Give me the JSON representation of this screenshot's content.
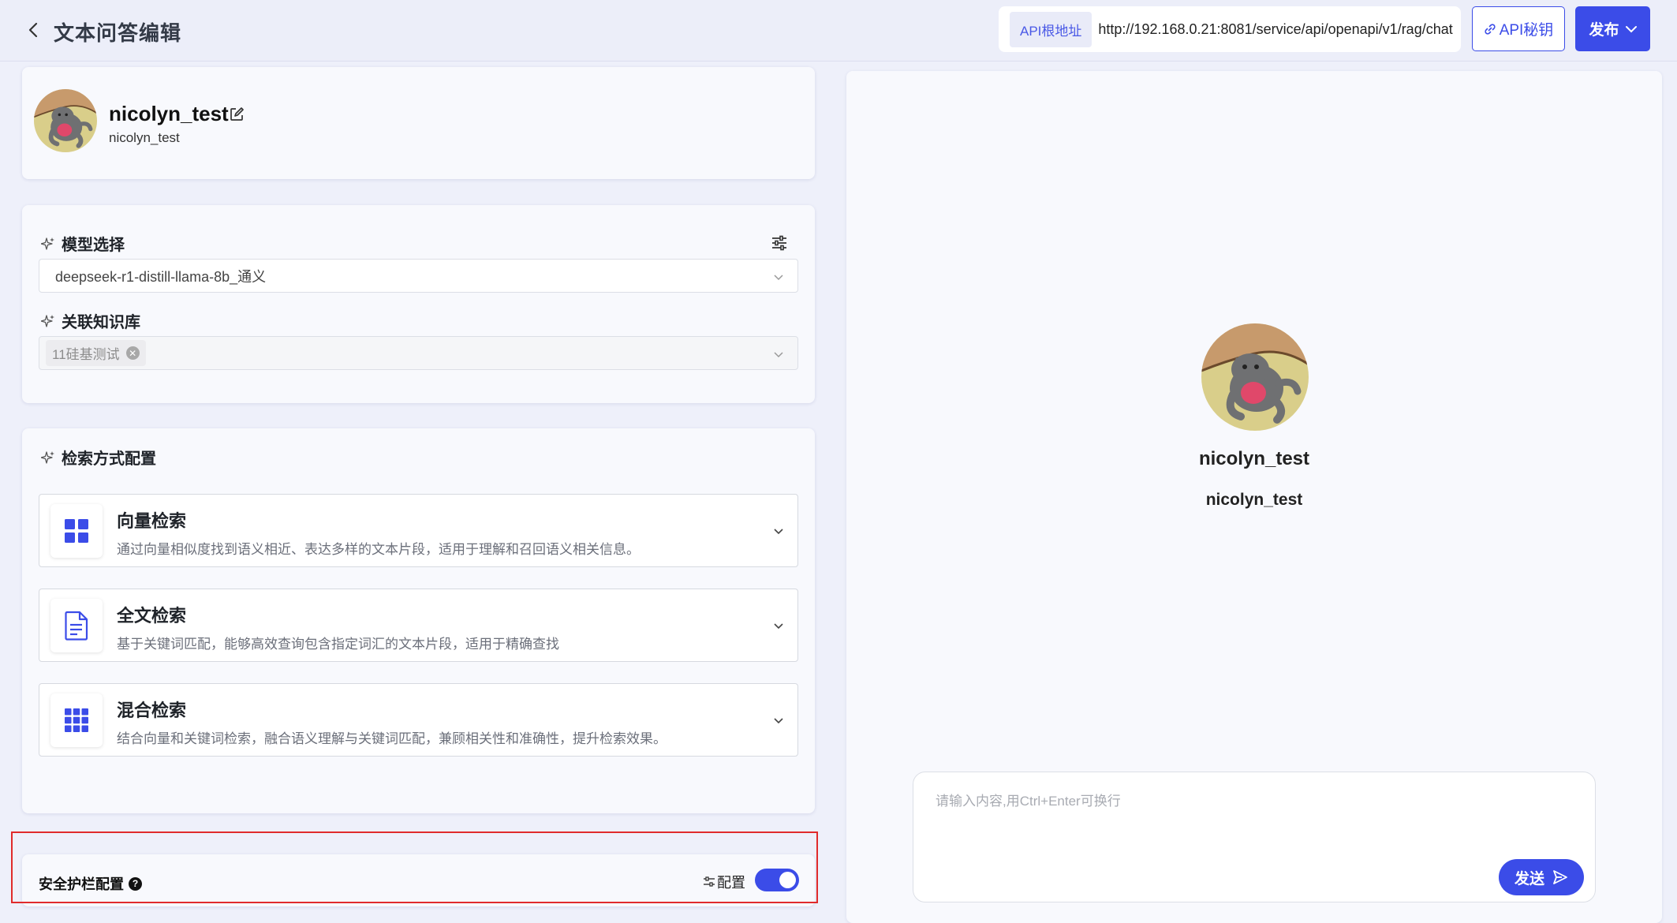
{
  "header": {
    "title": "文本问答编辑",
    "api_base_label": "API根地址",
    "api_base_url": "http://192.168.0.21:8081/service/api/openapi/v1/rag/chat",
    "api_secret_label": "API秘钥",
    "publish_label": "发布"
  },
  "profile": {
    "name": "nicolyn_test",
    "subtitle": "nicolyn_test"
  },
  "model": {
    "label": "模型选择",
    "selected": "deepseek-r1-distill-llama-8b_通义"
  },
  "knowledge": {
    "label": "关联知识库",
    "tags": [
      "11硅基测试"
    ]
  },
  "search": {
    "label": "检索方式配置",
    "options": [
      {
        "title": "向量检索",
        "desc": "通过向量相似度找到语义相近、表达多样的文本片段，适用于理解和召回语义相关信息。"
      },
      {
        "title": "全文检索",
        "desc": "基于关键词匹配，能够高效查询包含指定词汇的文本片段，适用于精确查找"
      },
      {
        "title": "混合检索",
        "desc": "结合向量和关键词检索，融合语义理解与关键词匹配，兼顾相关性和准确性，提升检索效果。"
      }
    ]
  },
  "guardrail": {
    "label": "安全护栏配置",
    "config_label": "配置",
    "enabled": true
  },
  "chat": {
    "name": "nicolyn_test",
    "subtitle": "nicolyn_test",
    "placeholder": "请输入内容,用Ctrl+Enter可换行",
    "send_label": "发送"
  },
  "colors": {
    "accent": "#3b4ce8",
    "highlight": "#e02b2b"
  }
}
